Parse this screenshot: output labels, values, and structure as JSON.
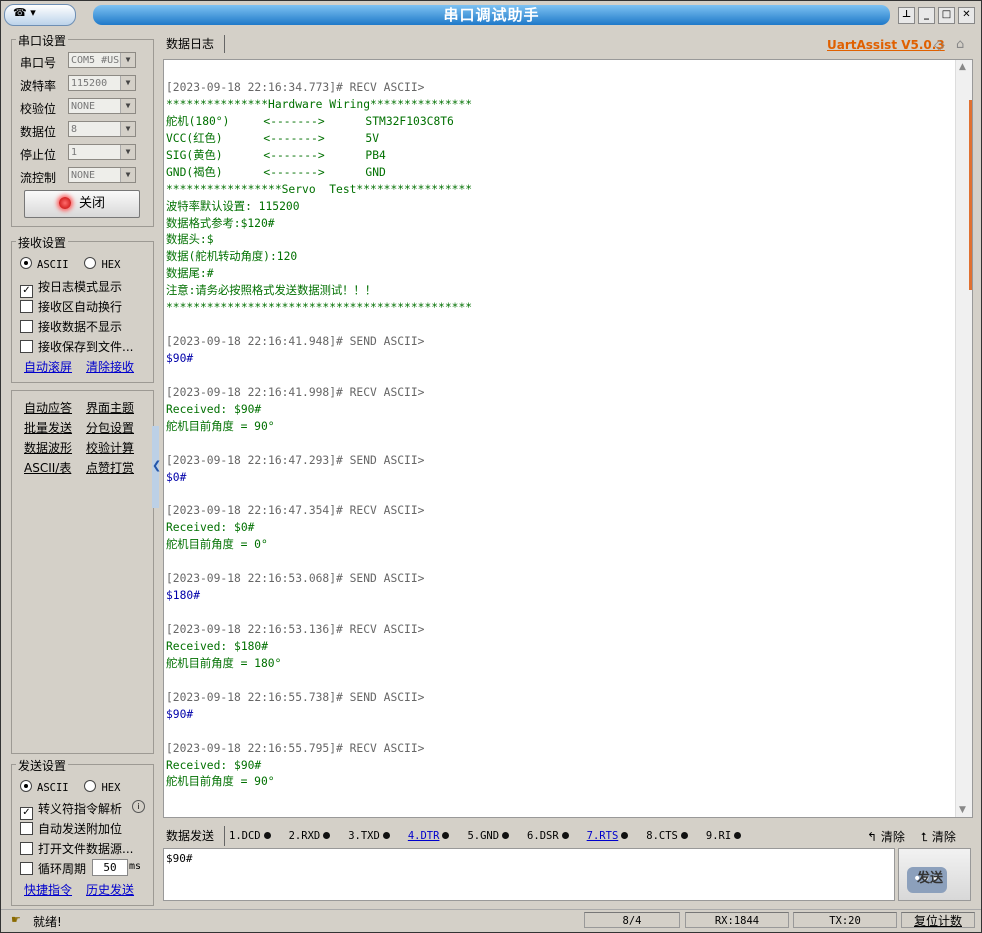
{
  "window": {
    "title": "串口调试助手",
    "sysmenu_glyph": "☎ ▾",
    "controls": {
      "pin": "⊥",
      "minimize": "_",
      "maximize": "□",
      "close": "✕"
    }
  },
  "serial_settings": {
    "title": "串口设置",
    "port_label": "串口号",
    "port_value": "COM5 #USB",
    "baud_label": "波特率",
    "baud_value": "115200",
    "parity_label": "校验位",
    "parity_value": "NONE",
    "databits_label": "数据位",
    "databits_value": "8",
    "stopbits_label": "停止位",
    "stopbits_value": "1",
    "flow_label": "流控制",
    "flow_value": "NONE",
    "close_button": "关闭"
  },
  "receive_settings": {
    "title": "接收设置",
    "ascii": "ASCII",
    "hex": "HEX",
    "options": [
      {
        "label": "按日志模式显示",
        "checked": true
      },
      {
        "label": "接收区自动换行",
        "checked": false
      },
      {
        "label": "接收数据不显示",
        "checked": false
      },
      {
        "label": "接收保存到文件...",
        "checked": false
      }
    ],
    "auto_scroll": "自动滚屏",
    "clear_receive": "清除接收"
  },
  "tools": [
    [
      "自动应答",
      "界面主题"
    ],
    [
      "批量发送",
      "分包设置"
    ],
    [
      "数据波形",
      "校验计算"
    ],
    [
      "ASCII/表",
      "点赞打赏"
    ]
  ],
  "send_settings": {
    "title": "发送设置",
    "ascii": "ASCII",
    "hex": "HEX",
    "options": [
      {
        "label": "转义符指令解析",
        "checked": true
      },
      {
        "label": "自动发送附加位",
        "checked": false
      },
      {
        "label": "打开文件数据源...",
        "checked": false
      },
      {
        "label": "循环周期",
        "checked": false
      }
    ],
    "period_value": "50",
    "period_unit": "ms",
    "shortcut": "快捷指令",
    "history": "历史发送"
  },
  "log": {
    "tab": "数据日志",
    "brand": "UartAssist V5.0.3",
    "lines": [
      {
        "t": "[2023-09-18 22:16:34.773]# RECV ASCII>",
        "c": "gray"
      },
      {
        "t": "***************Hardware Wiring***************",
        "c": "green"
      },
      {
        "t": "舵机(180°)     <------->      STM32F103C8T6",
        "c": "green"
      },
      {
        "t": "VCC(红色)      <------->      5V",
        "c": "green"
      },
      {
        "t": "SIG(黄色)      <------->      PB4",
        "c": "green"
      },
      {
        "t": "GND(褐色)      <------->      GND",
        "c": "green"
      },
      {
        "t": "*****************Servo  Test*****************",
        "c": "green"
      },
      {
        "t": "波特率默认设置: 115200",
        "c": "green"
      },
      {
        "t": "数据格式参考:$120#",
        "c": "green"
      },
      {
        "t": "数据头:$",
        "c": "green"
      },
      {
        "t": "数据(舵机转动角度):120",
        "c": "green"
      },
      {
        "t": "数据尾:#",
        "c": "green"
      },
      {
        "t": "注意:请务必按照格式发送数据测试！！！",
        "c": "green"
      },
      {
        "t": "*********************************************",
        "c": "green"
      },
      {
        "t": "",
        "c": "gray"
      },
      {
        "t": "[2023-09-18 22:16:41.948]# SEND ASCII>",
        "c": "gray"
      },
      {
        "t": "$90#",
        "c": "blue"
      },
      {
        "t": "",
        "c": "gray"
      },
      {
        "t": "[2023-09-18 22:16:41.998]# RECV ASCII>",
        "c": "gray"
      },
      {
        "t": "Received: $90#",
        "c": "green"
      },
      {
        "t": "舵机目前角度 = 90°",
        "c": "green"
      },
      {
        "t": "",
        "c": "gray"
      },
      {
        "t": "[2023-09-18 22:16:47.293]# SEND ASCII>",
        "c": "gray"
      },
      {
        "t": "$0#",
        "c": "blue"
      },
      {
        "t": "",
        "c": "gray"
      },
      {
        "t": "[2023-09-18 22:16:47.354]# RECV ASCII>",
        "c": "gray"
      },
      {
        "t": "Received: $0#",
        "c": "green"
      },
      {
        "t": "舵机目前角度 = 0°",
        "c": "green"
      },
      {
        "t": "",
        "c": "gray"
      },
      {
        "t": "[2023-09-18 22:16:53.068]# SEND ASCII>",
        "c": "gray"
      },
      {
        "t": "$180#",
        "c": "blue"
      },
      {
        "t": "",
        "c": "gray"
      },
      {
        "t": "[2023-09-18 22:16:53.136]# RECV ASCII>",
        "c": "gray"
      },
      {
        "t": "Received: $180#",
        "c": "green"
      },
      {
        "t": "舵机目前角度 = 180°",
        "c": "green"
      },
      {
        "t": "",
        "c": "gray"
      },
      {
        "t": "[2023-09-18 22:16:55.738]# SEND ASCII>",
        "c": "gray"
      },
      {
        "t": "$90#",
        "c": "blue"
      },
      {
        "t": "",
        "c": "gray"
      },
      {
        "t": "[2023-09-18 22:16:55.795]# RECV ASCII>",
        "c": "gray"
      },
      {
        "t": "Received: $90#",
        "c": "green"
      },
      {
        "t": "舵机目前角度 = 90°",
        "c": "green"
      }
    ]
  },
  "send": {
    "tab": "数据发送",
    "pins": [
      {
        "label": "1.DCD",
        "link": false
      },
      {
        "label": "2.RXD",
        "link": false
      },
      {
        "label": "3.TXD",
        "link": false
      },
      {
        "label": "4.DTR",
        "link": true
      },
      {
        "label": "5.GND",
        "link": false
      },
      {
        "label": "6.DSR",
        "link": false
      },
      {
        "label": "7.RTS",
        "link": true
      },
      {
        "label": "8.CTS",
        "link": false
      },
      {
        "label": "9.RI",
        "link": false
      }
    ],
    "clear1": "清除",
    "clear2": "清除",
    "input_value": "$90#",
    "send_button": "发送"
  },
  "status": {
    "text": "就绪!",
    "pages": "8/4",
    "rx": "RX:1844",
    "tx": "TX:20",
    "reset": "复位计数"
  },
  "colors": {
    "title_gradient_top": "#7ec2f2",
    "title_gradient_bottom": "#1f79c9",
    "brand": "#e06000",
    "recv_text": "#007000",
    "send_text": "#0000aa",
    "log_meta": "#666666"
  }
}
